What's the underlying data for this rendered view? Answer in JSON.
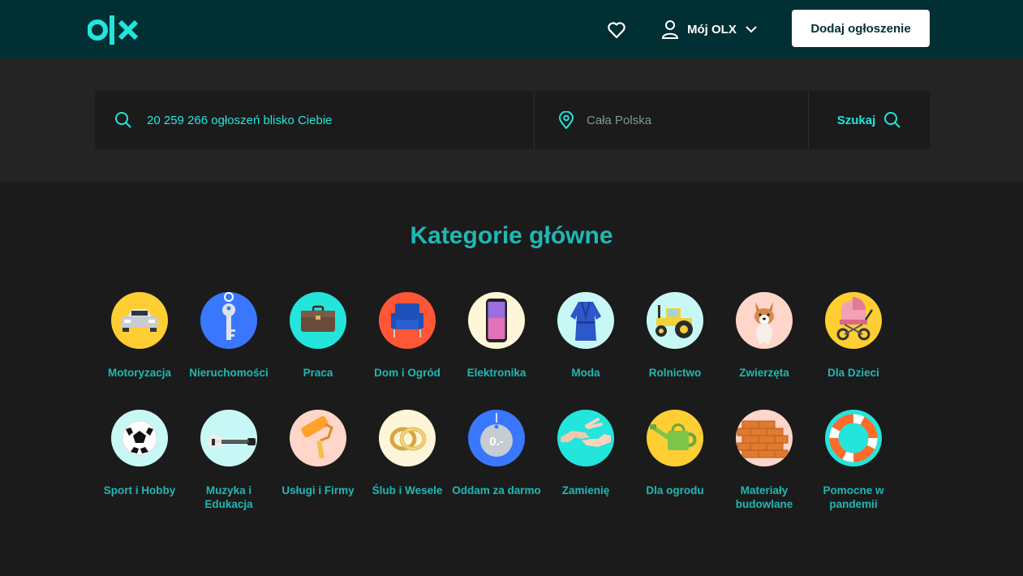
{
  "header": {
    "logo_text": "olx",
    "my_olx_label": "Mój OLX",
    "add_listing_label": "Dodaj ogłoszenie"
  },
  "search": {
    "query_placeholder": "20 259 266 ogłoszeń blisko Ciebie",
    "location_placeholder": "Cała Polska",
    "button_label": "Szukaj"
  },
  "categories": {
    "title": "Kategorie główne",
    "items": [
      {
        "label": "Motoryzacja",
        "icon": "car-icon",
        "color": "#ffce32"
      },
      {
        "label": "Nieruchomości",
        "icon": "key-icon",
        "color": "#3a77ff"
      },
      {
        "label": "Praca",
        "icon": "briefcase-icon",
        "color": "#23e5db"
      },
      {
        "label": "Dom i Ogród",
        "icon": "armchair-icon",
        "color": "#ff5636"
      },
      {
        "label": "Elektronika",
        "icon": "smartphone-icon",
        "color": "#fff6d9"
      },
      {
        "label": "Moda",
        "icon": "bathrobe-icon",
        "color": "#c8f8f6"
      },
      {
        "label": "Rolnictwo",
        "icon": "tractor-icon",
        "color": "#c8f8f6"
      },
      {
        "label": "Zwierzęta",
        "icon": "dog-icon",
        "color": "#ffd6c9"
      },
      {
        "label": "Dla Dzieci",
        "icon": "stroller-icon",
        "color": "#ffce32"
      },
      {
        "label": "Sport i Hobby",
        "icon": "football-icon",
        "color": "#c8f8f6"
      },
      {
        "label": "Muzyka i Edukacja",
        "icon": "guitar-icon",
        "color": "#c8f8f6"
      },
      {
        "label": "Usługi i Firmy",
        "icon": "paint-roller-icon",
        "color": "#ffd6c9"
      },
      {
        "label": "Ślub i Wesele",
        "icon": "rings-icon",
        "color": "#fff6d9"
      },
      {
        "label": "Oddam za darmo",
        "icon": "price-tag-icon",
        "color": "#3a77ff",
        "icon_text": "0.-"
      },
      {
        "label": "Zamienię",
        "icon": "handshake-icon",
        "color": "#23e5db"
      },
      {
        "label": "Dla ogrodu",
        "icon": "watering-can-icon",
        "color": "#ffce32"
      },
      {
        "label": "Materiały budowlane",
        "icon": "bricks-icon",
        "color": "#ffd6c9"
      },
      {
        "label": "Pomocne w pandemii",
        "icon": "lifebuoy-icon",
        "color": "#23e5db"
      }
    ]
  },
  "colors": {
    "header_bg": "#002f34",
    "accent": "#23e5db",
    "page_bg": "#1b1b1b"
  }
}
